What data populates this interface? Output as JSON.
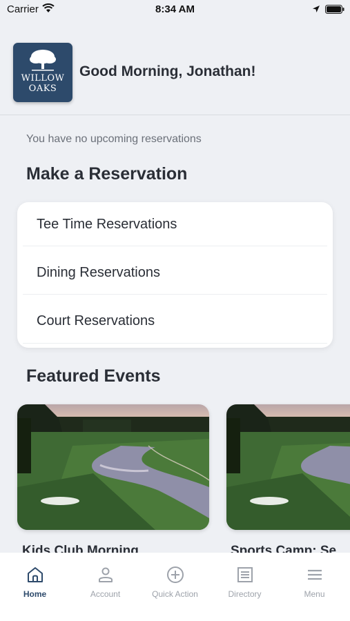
{
  "status_bar": {
    "carrier": "Carrier",
    "time": "8:34 AM"
  },
  "header": {
    "logo_line1": "WILLOW",
    "logo_line2": "OAKS",
    "greeting": "Good Morning, Jonathan!"
  },
  "reservations": {
    "empty_message": "You have no upcoming reservations",
    "section_title": "Make a Reservation",
    "items": [
      {
        "label": "Tee Time Reservations"
      },
      {
        "label": "Dining Reservations"
      },
      {
        "label": "Court Reservations"
      }
    ]
  },
  "events": {
    "section_title": "Featured Events",
    "items": [
      {
        "title": "Kids Club Morning"
      },
      {
        "title": "Sports Camp: Se"
      }
    ]
  },
  "tab_bar": {
    "active": "Home",
    "tabs": [
      {
        "label": "Home",
        "icon": "home-icon"
      },
      {
        "label": "Account",
        "icon": "user-icon"
      },
      {
        "label": "Quick Action",
        "icon": "plus-circle-icon"
      },
      {
        "label": "Directory",
        "icon": "directory-icon"
      },
      {
        "label": "Menu",
        "icon": "menu-icon"
      }
    ]
  },
  "colors": {
    "brand": "#2d4a6b",
    "background": "#eef0f4",
    "inactive_tab": "#9da2aa"
  }
}
